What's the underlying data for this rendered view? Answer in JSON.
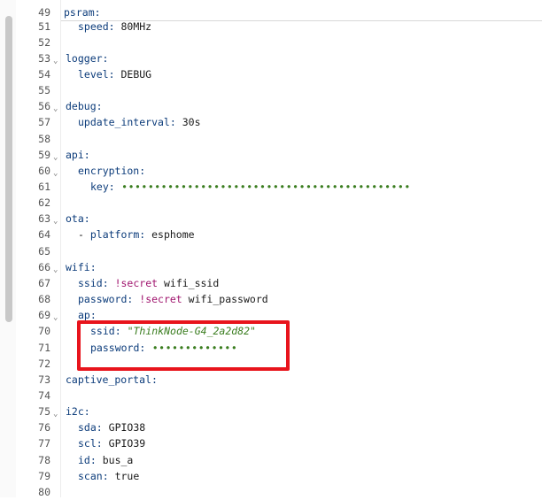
{
  "header_line": {
    "number": "49",
    "key": "psram"
  },
  "lines": [
    {
      "n": "51",
      "indent": 1,
      "key": "speed",
      "val": "80MHz",
      "kind": "plain"
    },
    {
      "n": "52"
    },
    {
      "n": "53",
      "fold": true,
      "indent": 0,
      "key": "logger"
    },
    {
      "n": "54",
      "indent": 1,
      "key": "level",
      "val": "DEBUG",
      "kind": "plain"
    },
    {
      "n": "55"
    },
    {
      "n": "56",
      "fold": true,
      "indent": 0,
      "key": "debug"
    },
    {
      "n": "57",
      "indent": 1,
      "key": "update_interval",
      "val": "30s",
      "kind": "plain"
    },
    {
      "n": "58"
    },
    {
      "n": "59",
      "fold": true,
      "indent": 0,
      "key": "api"
    },
    {
      "n": "60",
      "fold": true,
      "indent": 1,
      "key": "encryption"
    },
    {
      "n": "61",
      "indent": 2,
      "key": "key",
      "val": "••••••••••••••••••••••••••••••••••••••••••••",
      "kind": "dots"
    },
    {
      "n": "62"
    },
    {
      "n": "63",
      "fold": true,
      "indent": 0,
      "key": "ota"
    },
    {
      "n": "64",
      "indent": 1,
      "key": "platform",
      "val": "esphome",
      "kind": "list"
    },
    {
      "n": "65"
    },
    {
      "n": "66",
      "fold": true,
      "indent": 0,
      "key": "wifi"
    },
    {
      "n": "67",
      "indent": 1,
      "key": "ssid",
      "tag": "!secret",
      "val": "wifi_ssid",
      "kind": "tag"
    },
    {
      "n": "68",
      "indent": 1,
      "key": "password",
      "tag": "!secret",
      "val": "wifi_password",
      "kind": "tag"
    },
    {
      "n": "69",
      "fold": true,
      "indent": 1,
      "key": "ap"
    },
    {
      "n": "70",
      "indent": 2,
      "key": "ssid",
      "val": "\"ThinkNode-G4_2a2d82\"",
      "kind": "str"
    },
    {
      "n": "71",
      "indent": 2,
      "key": "password",
      "val": "•••••••••••••",
      "kind": "dots"
    },
    {
      "n": "72"
    },
    {
      "n": "73",
      "indent": 0,
      "key": "captive_portal"
    },
    {
      "n": "74"
    },
    {
      "n": "75",
      "fold": true,
      "indent": 0,
      "key": "i2c"
    },
    {
      "n": "76",
      "indent": 1,
      "key": "sda",
      "val": "GPIO38",
      "kind": "plain"
    },
    {
      "n": "77",
      "indent": 1,
      "key": "scl",
      "val": "GPIO39",
      "kind": "plain"
    },
    {
      "n": "78",
      "indent": 1,
      "key": "id",
      "val": "bus_a",
      "kind": "plain"
    },
    {
      "n": "79",
      "indent": 1,
      "key": "scan",
      "val": "true",
      "kind": "plain"
    },
    {
      "n": "80"
    }
  ]
}
